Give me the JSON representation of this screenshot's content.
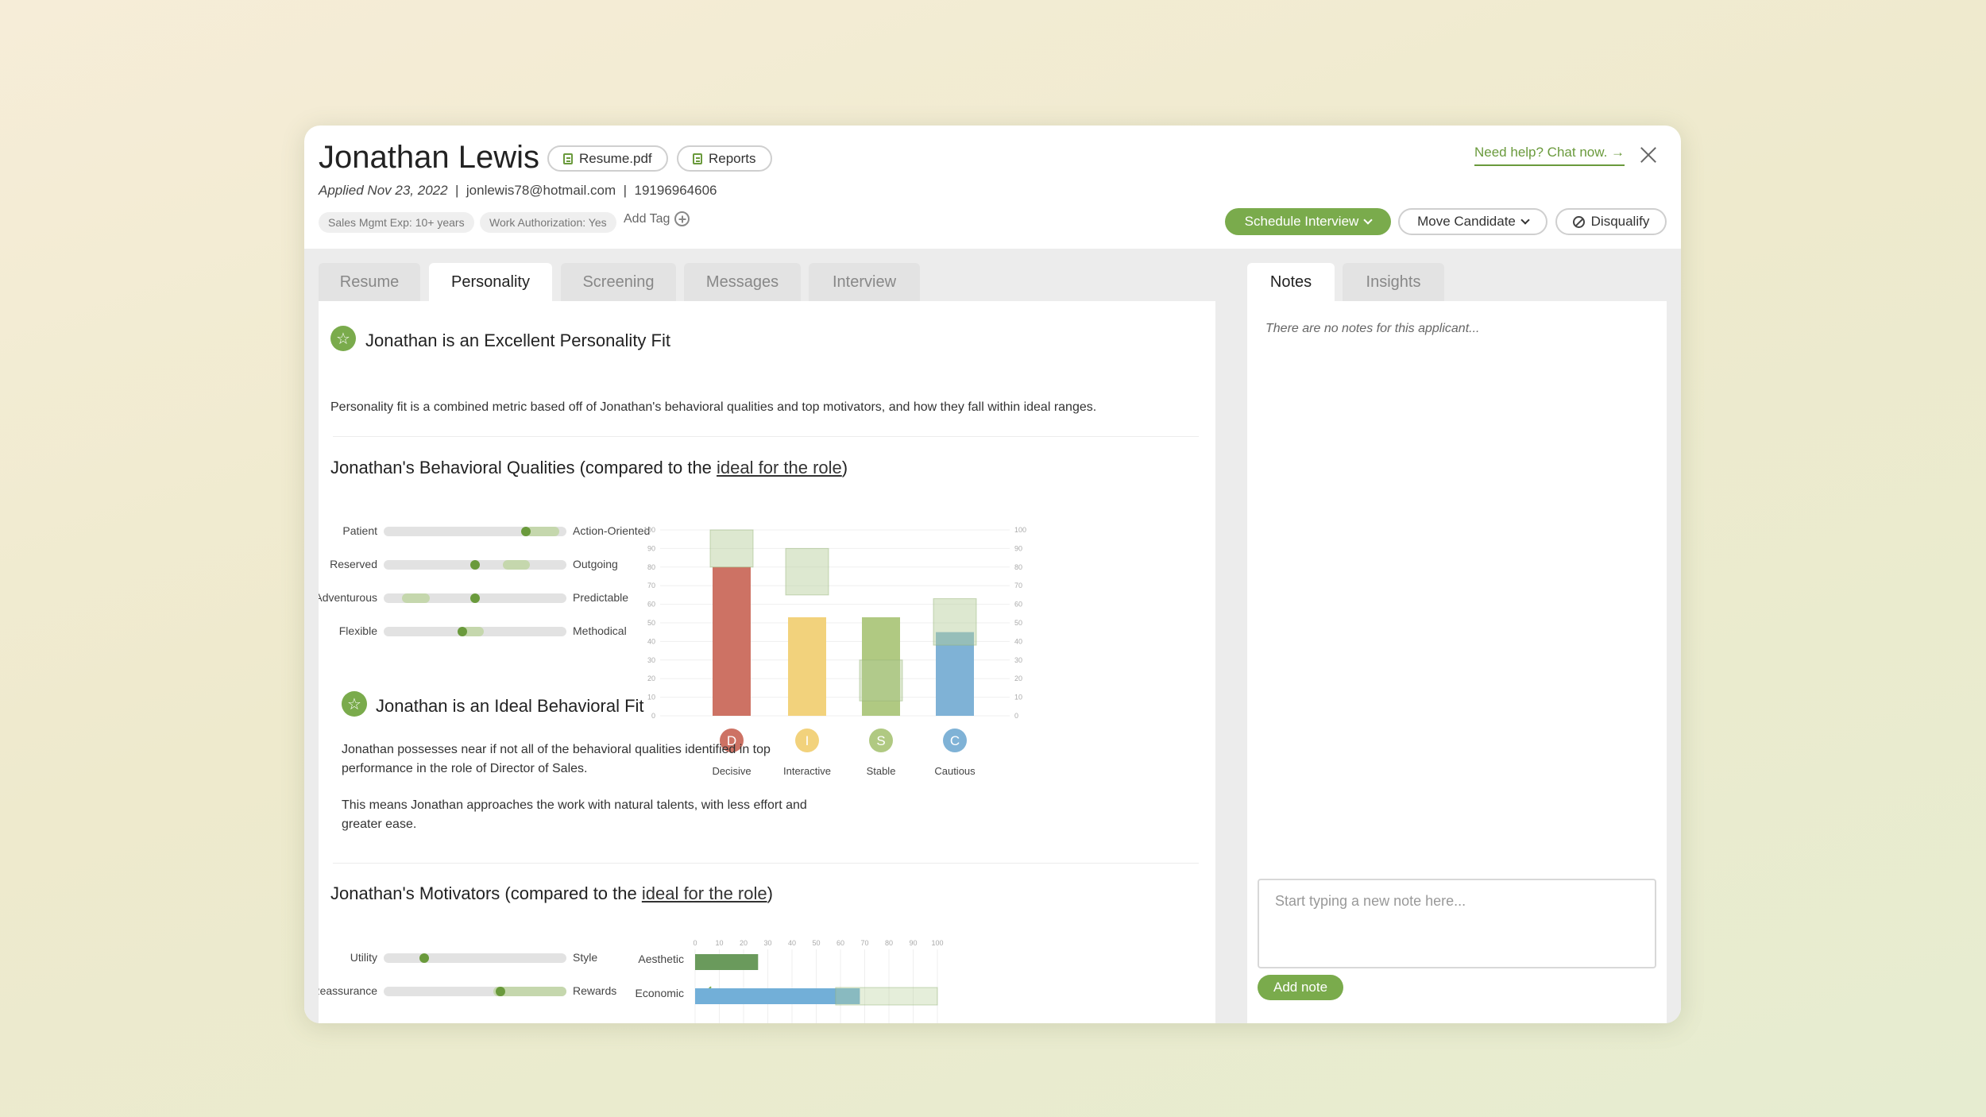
{
  "candidate": {
    "name": "Jonathan Lewis",
    "applied": "Applied Nov 23, 2022",
    "email": "jonlewis78@hotmail.com",
    "phone": "19196964606",
    "sep": "|"
  },
  "header": {
    "resume_btn": "Resume.pdf",
    "reports_btn": "Reports",
    "help_link": "Need help? Chat now. →",
    "tags": [
      "Sales Mgmt Exp: 10+ years",
      "Work Authorization: Yes"
    ],
    "add_tag": "Add Tag"
  },
  "actions": {
    "schedule": "Schedule Interview",
    "move": "Move Candidate",
    "disqualify": "Disqualify"
  },
  "tabs": [
    "Resume",
    "Personality",
    "Screening",
    "Messages",
    "Interview"
  ],
  "side_tabs": [
    "Notes",
    "Insights"
  ],
  "personality": {
    "fit_title": "Jonathan is an Excellent Personality Fit",
    "fit_desc": "Personality fit is a combined metric based off of Jonathan's behavioral qualities and top motivators, and how they fall within ideal ranges.",
    "behavior_heading": "Jonathan's Behavioral Qualities (compared to the ",
    "ideal_link": "ideal for the role",
    "close_paren": ")",
    "behavior_fit_title": "Jonathan is an Ideal Behavioral Fit",
    "behavior_p1": "Jonathan possesses near if not all of the behavioral qualities identified in top performance in the role of Director of Sales.",
    "behavior_p2": "This means Jonathan approaches the work with natural talents, with less effort and greater ease.",
    "motivators_heading": "Jonathan's Motivators (compared to the "
  },
  "behavior_sliders": [
    {
      "left": "Patient",
      "right": "Action-Oriented",
      "value": 0.78,
      "range": [
        0.78,
        0.96
      ]
    },
    {
      "left": "Reserved",
      "right": "Outgoing",
      "value": 0.5,
      "range": [
        0.65,
        0.8
      ]
    },
    {
      "left": "Adventurous",
      "right": "Predictable",
      "value": 0.5,
      "range": [
        0.1,
        0.25
      ]
    },
    {
      "left": "Flexible",
      "right": "Methodical",
      "value": 0.43,
      "range": [
        0.43,
        0.55
      ]
    }
  ],
  "motivator_sliders": [
    {
      "left": "Utility",
      "right": "Style",
      "value": 0.22,
      "range": null,
      "check": false
    },
    {
      "left": "Reassurance",
      "right": "Rewards",
      "value": 0.64,
      "range": [
        0.6,
        1.0
      ],
      "check": true
    }
  ],
  "chart_data": [
    {
      "type": "bar",
      "categories": [
        "Decisive",
        "Interactive",
        "Stable",
        "Cautious"
      ],
      "letters": [
        "D",
        "I",
        "S",
        "C"
      ],
      "values": [
        80,
        53,
        53,
        45
      ],
      "ideal_ranges": [
        [
          80,
          100
        ],
        [
          65,
          90
        ],
        [
          8,
          30
        ],
        [
          38,
          63
        ]
      ],
      "ylim": [
        0,
        100
      ],
      "yticks": [
        0,
        10,
        20,
        30,
        40,
        50,
        60,
        70,
        80,
        90,
        100
      ],
      "colors": [
        "#cd7264",
        "#f2d27c",
        "#b0c982",
        "#7fb2d6"
      ]
    },
    {
      "type": "bar",
      "orientation": "horizontal",
      "categories": [
        "Aesthetic",
        "Economic"
      ],
      "values": [
        26,
        68
      ],
      "ideal_ranges": [
        null,
        [
          58,
          100
        ]
      ],
      "xlim": [
        0,
        100
      ],
      "xticks": [
        0,
        10,
        20,
        30,
        40,
        50,
        60,
        70,
        80,
        90,
        100
      ],
      "colors": [
        "#6a9a5c",
        "#72afd8"
      ]
    }
  ],
  "notes": {
    "empty": "There are no notes for this applicant...",
    "placeholder": "Start typing a new note here...",
    "add_btn": "Add note"
  }
}
